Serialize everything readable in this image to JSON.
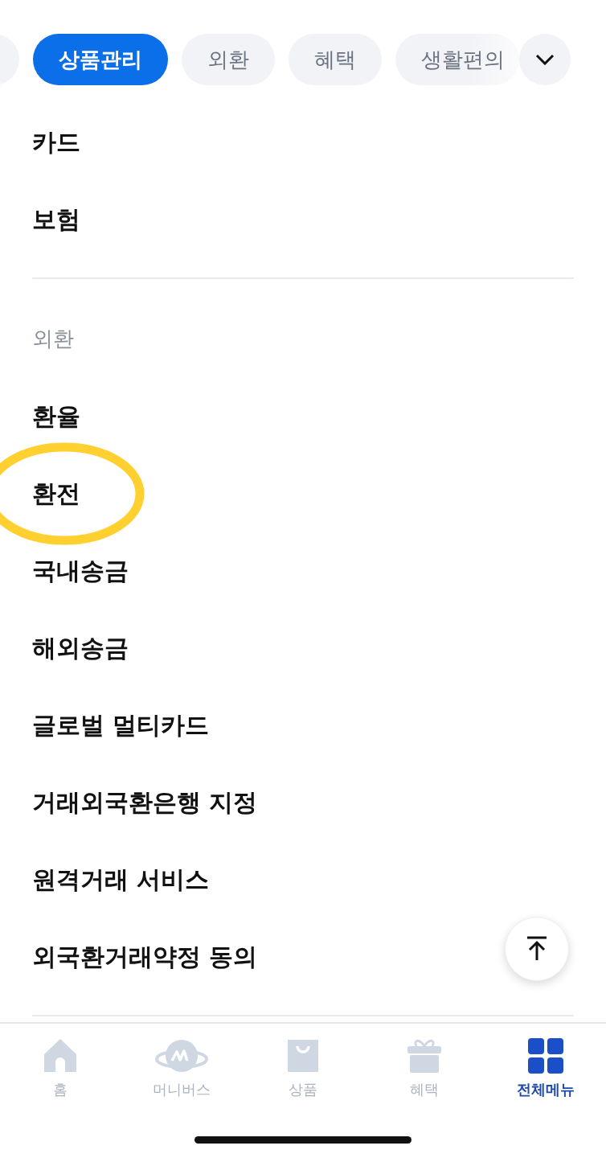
{
  "category_tabs": [
    {
      "selected": false
    },
    {
      "label": "상품관리",
      "selected": true
    },
    {
      "label": "외환",
      "selected": false
    },
    {
      "label": "혜택",
      "selected": false
    },
    {
      "label": "생활편의",
      "selected": false
    }
  ],
  "sections": [
    {
      "items": [
        {
          "label": "카드",
          "highlighted": false
        },
        {
          "label": "보험",
          "highlighted": false
        }
      ]
    },
    {
      "label": "외환",
      "items": [
        {
          "label": "환율",
          "highlighted": false
        },
        {
          "label": "환전",
          "highlighted": true
        },
        {
          "label": "국내송금",
          "highlighted": false
        },
        {
          "label": "해외송금",
          "highlighted": false
        },
        {
          "label": "글로벌 멀티카드",
          "highlighted": false
        },
        {
          "label": "거래외국환은행 지정",
          "highlighted": false
        },
        {
          "label": "원격거래 서비스",
          "highlighted": false
        },
        {
          "label": "외국환거래약정 동의",
          "highlighted": false
        }
      ]
    }
  ],
  "bottom_nav": [
    {
      "kind": "home",
      "label": "홈",
      "selected": false
    },
    {
      "kind": "planet",
      "label": "머니버스",
      "selected": false
    },
    {
      "kind": "bag",
      "label": "상품",
      "selected": false
    },
    {
      "kind": "gift",
      "label": "혜택",
      "selected": false
    },
    {
      "kind": "grid",
      "label": "전체메뉴",
      "selected": true
    }
  ]
}
